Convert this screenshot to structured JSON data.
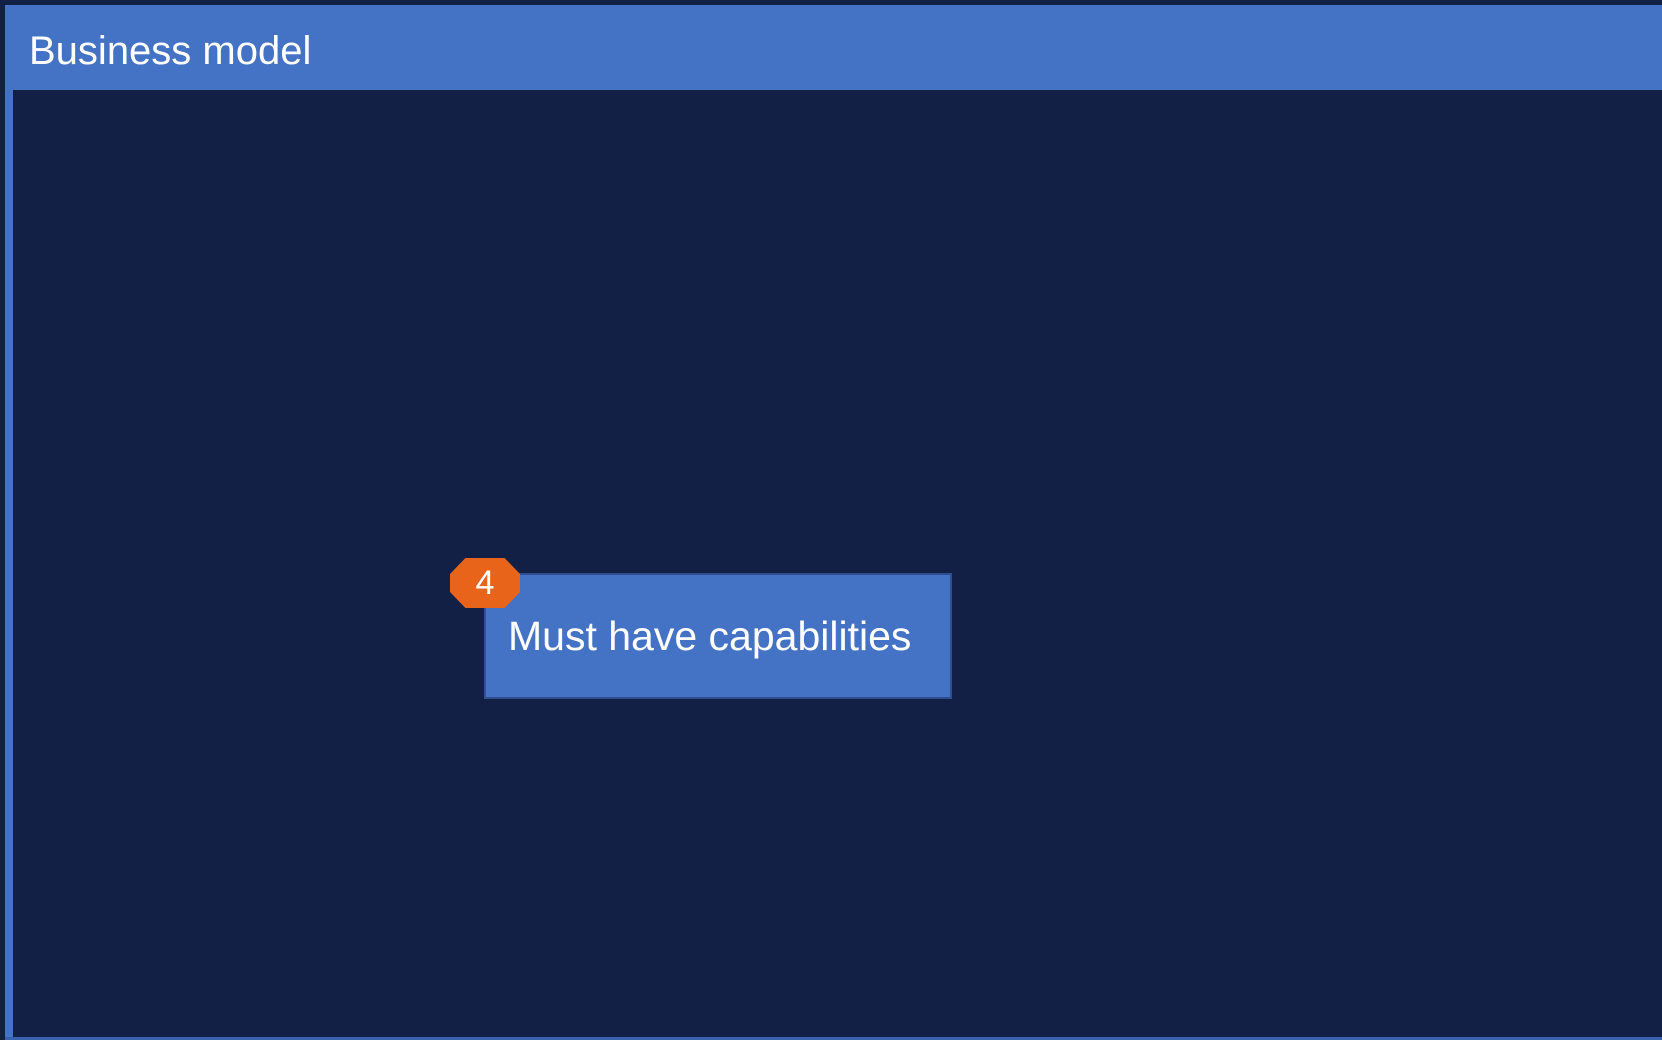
{
  "header": {
    "title": "Business model"
  },
  "diagram": {
    "nodes": [
      {
        "step": "4",
        "label": "Must have capabilities"
      }
    ]
  },
  "colors": {
    "background": "#122046",
    "accent_blue": "#4472C4",
    "badge_orange": "#E8641B",
    "text": "#FFFFFF"
  }
}
